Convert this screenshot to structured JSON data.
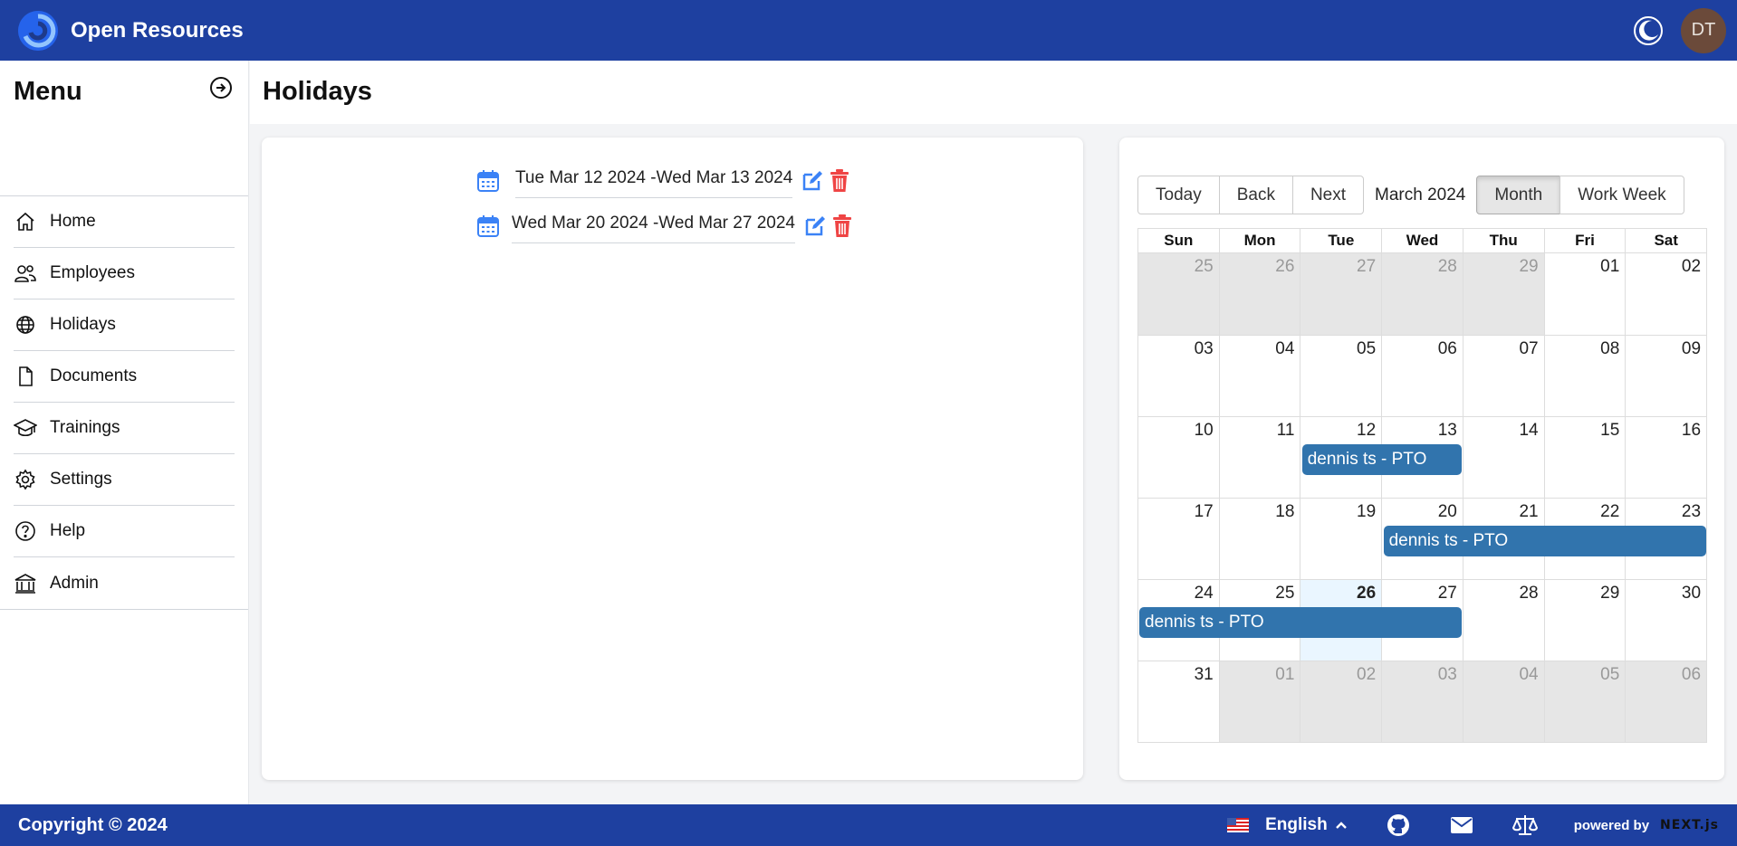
{
  "app": {
    "title": "Open Resources"
  },
  "header": {
    "avatar_initials": "DT",
    "theme_icon": "moon-icon"
  },
  "sidebar": {
    "title": "Menu",
    "collapse_icon": "circle-arrow-right-icon",
    "items": [
      {
        "label": "Home",
        "icon": "home-icon"
      },
      {
        "label": "Employees",
        "icon": "users-icon"
      },
      {
        "label": "Holidays",
        "icon": "globe-icon"
      },
      {
        "label": "Documents",
        "icon": "document-icon"
      },
      {
        "label": "Trainings",
        "icon": "graduation-cap-icon"
      },
      {
        "label": "Settings",
        "icon": "gear-icon"
      },
      {
        "label": "Help",
        "icon": "help-circle-icon"
      },
      {
        "label": "Admin",
        "icon": "bank-icon"
      }
    ]
  },
  "page": {
    "title": "Holidays"
  },
  "holidays": [
    {
      "range": "Tue Mar 12 2024 -Wed Mar 13 2024"
    },
    {
      "range": "Wed Mar 20 2024 -Wed Mar 27 2024"
    }
  ],
  "calendar": {
    "toolbar": {
      "today": "Today",
      "back": "Back",
      "next": "Next",
      "label": "March 2024",
      "month": "Month",
      "work_week": "Work Week",
      "active_view": "Month"
    },
    "days_of_week": [
      "Sun",
      "Mon",
      "Tue",
      "Wed",
      "Thu",
      "Fri",
      "Sat"
    ],
    "weeks": [
      [
        "25",
        "26",
        "27",
        "28",
        "29",
        "01",
        "02"
      ],
      [
        "03",
        "04",
        "05",
        "06",
        "07",
        "08",
        "09"
      ],
      [
        "10",
        "11",
        "12",
        "13",
        "14",
        "15",
        "16"
      ],
      [
        "17",
        "18",
        "19",
        "20",
        "21",
        "22",
        "23"
      ],
      [
        "24",
        "25",
        "26",
        "27",
        "28",
        "29",
        "30"
      ],
      [
        "31",
        "01",
        "02",
        "03",
        "04",
        "05",
        "06"
      ]
    ],
    "today": "26",
    "event_color": "#3174ad",
    "events": [
      {
        "title": "dennis ts - PTO",
        "start": "2024-03-12",
        "end": "2024-03-13"
      },
      {
        "title": "dennis ts - PTO",
        "start": "2024-03-20",
        "end": "2024-03-23"
      },
      {
        "title": "dennis ts - PTO",
        "start": "2024-03-24",
        "end": "2024-03-27"
      }
    ]
  },
  "footer": {
    "copyright": "Copyright © 2024",
    "language": "English",
    "powered_by": "powered by",
    "powered_brand": "NEXT.js"
  },
  "colors": {
    "brand": "#1e40a0",
    "danger": "#ef4444",
    "accent": "#3b82f6"
  }
}
